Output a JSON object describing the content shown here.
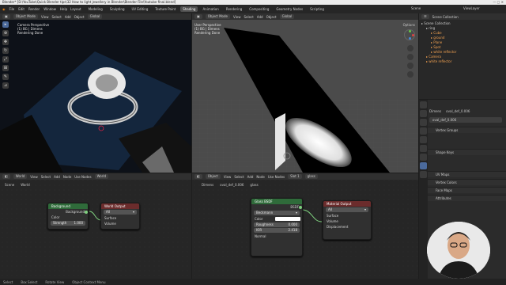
{
  "window_title": "Blender* [D:\\YouTube\\Quick Blender tips\\32 How to light jewellery in Blender\\Blender File\\Youtube final.blend]",
  "menu": [
    "File",
    "Edit",
    "Render",
    "Window",
    "Help"
  ],
  "workspace_tabs": [
    {
      "label": "Layout",
      "active": false
    },
    {
      "label": "Modeling",
      "active": false
    },
    {
      "label": "Sculpting",
      "active": false
    },
    {
      "label": "UV Editing",
      "active": false
    },
    {
      "label": "Texture Paint",
      "active": false
    },
    {
      "label": "Shading",
      "active": true
    },
    {
      "label": "Animation",
      "active": false
    },
    {
      "label": "Rendering",
      "active": false
    },
    {
      "label": "Compositing",
      "active": false
    },
    {
      "label": "Geometry Nodes",
      "active": false
    },
    {
      "label": "Scripting",
      "active": false
    }
  ],
  "scene_field": "Scene",
  "view_layer_field": "ViewLayer",
  "viewport_left": {
    "header": [
      "Object Mode",
      "View",
      "Select",
      "Add",
      "Object",
      "Global"
    ],
    "info_line1": "Camera Perspective",
    "info_line2": "(1) BG | Dimens",
    "info_line3": "Rendering Done"
  },
  "viewport_right": {
    "header": [
      "Object Mode",
      "View",
      "Select",
      "Add",
      "Object",
      "Global"
    ],
    "info_line1": "User Perspective",
    "info_line2": "(1) BG | Dimens",
    "info_line3": "Rendering Done",
    "options_label": "Options"
  },
  "node_editor_left": {
    "header": [
      "World",
      "View",
      "Select",
      "Add",
      "Node",
      "Use Nodes",
      "World"
    ],
    "breadcrumb": [
      "Scene",
      "World"
    ],
    "background_node": {
      "title": "Background",
      "out": "Background",
      "in": [
        "Color",
        "Strength"
      ],
      "strength_label": "Strength",
      "strength_value": "1.000"
    },
    "world_output_node": {
      "title": "World Output",
      "target": "All",
      "in": [
        "Surface",
        "Volume"
      ]
    }
  },
  "node_editor_right": {
    "header": [
      "Object",
      "View",
      "Select",
      "Add",
      "Node",
      "Use Nodes",
      "Slot 1",
      "glass"
    ],
    "breadcrumb": [
      "Dimens",
      "oval_def_0.006",
      "glass"
    ],
    "glass_node": {
      "title": "Glass BSDF",
      "out": "BSDF",
      "distribution": "Beckmann",
      "color_label": "Color",
      "roughness_label": "Roughness",
      "roughness_value": "0.000",
      "ior_label": "IOR",
      "ior_value": "2.418",
      "normal_label": "Normal"
    },
    "material_output_node": {
      "title": "Material Output",
      "target": "All",
      "in": [
        "Surface",
        "Volume",
        "Displacement"
      ]
    }
  },
  "outliner": {
    "header": "Scene Collection",
    "items": [
      {
        "label": "Scene Collection",
        "depth": 0,
        "color": "#cfcfcf"
      },
      {
        "label": "ring",
        "depth": 1,
        "color": "#cfcfcf"
      },
      {
        "label": "Cube",
        "depth": 2,
        "color": "#f0a050"
      },
      {
        "label": "ground",
        "depth": 2,
        "color": "#f0a050"
      },
      {
        "label": "Plane",
        "depth": 2,
        "color": "#f0a050"
      },
      {
        "label": "Spot",
        "depth": 2,
        "color": "#f0a050"
      },
      {
        "label": "white reflector",
        "depth": 2,
        "color": "#f0a050"
      },
      {
        "label": "Camera",
        "depth": 1,
        "color": "#f0a050"
      },
      {
        "label": "white reflector",
        "depth": 1,
        "color": "#f0a050"
      }
    ]
  },
  "properties": {
    "object_name": "Dimens",
    "data_name": "oval_def_0.006",
    "field_name": "oval_def_0.006",
    "sections": [
      "Vertex Groups",
      "Shape Keys",
      "UV Maps",
      "Vertex Colors",
      "Face Maps",
      "Attributes"
    ]
  },
  "status_bar": [
    "Select",
    "Box Select",
    "Rotate View",
    "Object Context Menu"
  ],
  "accent_color": "#4b6a9c"
}
